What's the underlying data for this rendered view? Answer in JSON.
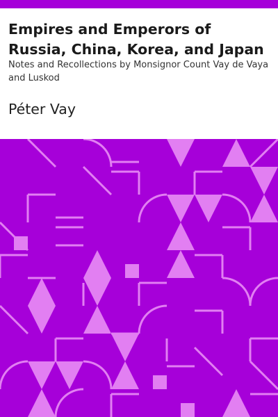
{
  "book": {
    "title": "Empires and Emperors of Russia, China, Korea, and Japan",
    "subtitle": "Notes and Recollections by Monsignor Count Vay de Vaya and Luskod",
    "author": "Péter Vay"
  },
  "colors": {
    "band": "#a600d9",
    "background": "#a600d9",
    "motif": "#e27ff2",
    "text": "#1a1a1a"
  }
}
